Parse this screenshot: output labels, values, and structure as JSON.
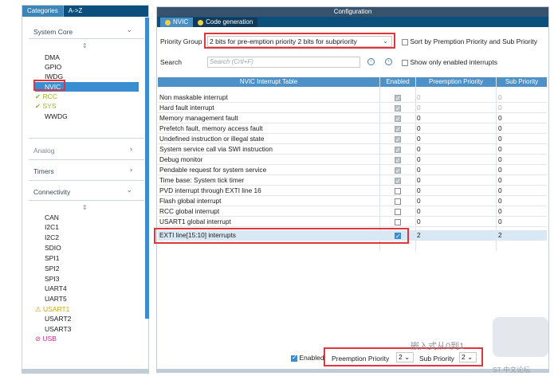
{
  "left": {
    "tabs": [
      "Categories",
      "A->Z"
    ],
    "system_core": {
      "header": "System Core",
      "items": [
        "DMA",
        "GPIO",
        "IWDG",
        "NVIC",
        "RCC",
        "SYS",
        "WWDG"
      ]
    },
    "analog": "Analog",
    "timers": "Timers",
    "connectivity": {
      "header": "Connectivity",
      "items": [
        "CAN",
        "I2C1",
        "I2C2",
        "SDIO",
        "SPI1",
        "SPI2",
        "SPI3",
        "UART4",
        "UART5",
        "USART1",
        "USART2",
        "USART3",
        "USB"
      ]
    }
  },
  "right": {
    "title": "Configuration",
    "tabs": [
      "NVIC",
      "Code generation"
    ],
    "priority_group_label": "Priority Group",
    "priority_group_value": "2 bits for pre-emption priority 2 bits for subpriority",
    "sort_label": "Sort by Premption Priority and Sub Priority",
    "search_label": "Search",
    "search_placeholder": "Search (Crtl+F)",
    "show_enabled_label": "Show only enabled interrupts",
    "columns": [
      "NVIC Interrupt Table",
      "Enabled",
      "Preemption Priority",
      "Sub Priority"
    ],
    "rows": [
      {
        "name": "Non maskable interrupt",
        "pre": "0",
        "sub": "0"
      },
      {
        "name": "Hard fault interrupt",
        "pre": "0",
        "sub": "0"
      },
      {
        "name": "Memory management fault",
        "pre": "0",
        "sub": "0"
      },
      {
        "name": "Prefetch fault, memory access fault",
        "pre": "0",
        "sub": "0"
      },
      {
        "name": "Undefined instruction or illegal state",
        "pre": "0",
        "sub": "0"
      },
      {
        "name": "System service call via SWI instruction",
        "pre": "0",
        "sub": "0"
      },
      {
        "name": "Debug monitor",
        "pre": "0",
        "sub": "0"
      },
      {
        "name": "Pendable request for system service",
        "pre": "0",
        "sub": "0"
      },
      {
        "name": "Time base: System tick timer",
        "pre": "0",
        "sub": "0"
      },
      {
        "name": "PVD interrupt through EXTI line 16",
        "pre": "0",
        "sub": "0"
      },
      {
        "name": "Flash global interrupt",
        "pre": "0",
        "sub": "0"
      },
      {
        "name": "RCC global interrupt",
        "pre": "0",
        "sub": "0"
      },
      {
        "name": "USART1 global interrupt",
        "pre": "0",
        "sub": "0"
      },
      {
        "name": "EXTI line[15:10] interrupts",
        "pre": "2",
        "sub": "2"
      }
    ],
    "bottom": {
      "enabled_label": "Enabled",
      "preemption_label": "Preemption Priority",
      "preemption_value": "2",
      "sub_label": "Sub Priority",
      "sub_value": "2"
    }
  },
  "watermark": {
    "line1": "嵌入式从0到1",
    "line2": "ST 中文论坛"
  }
}
